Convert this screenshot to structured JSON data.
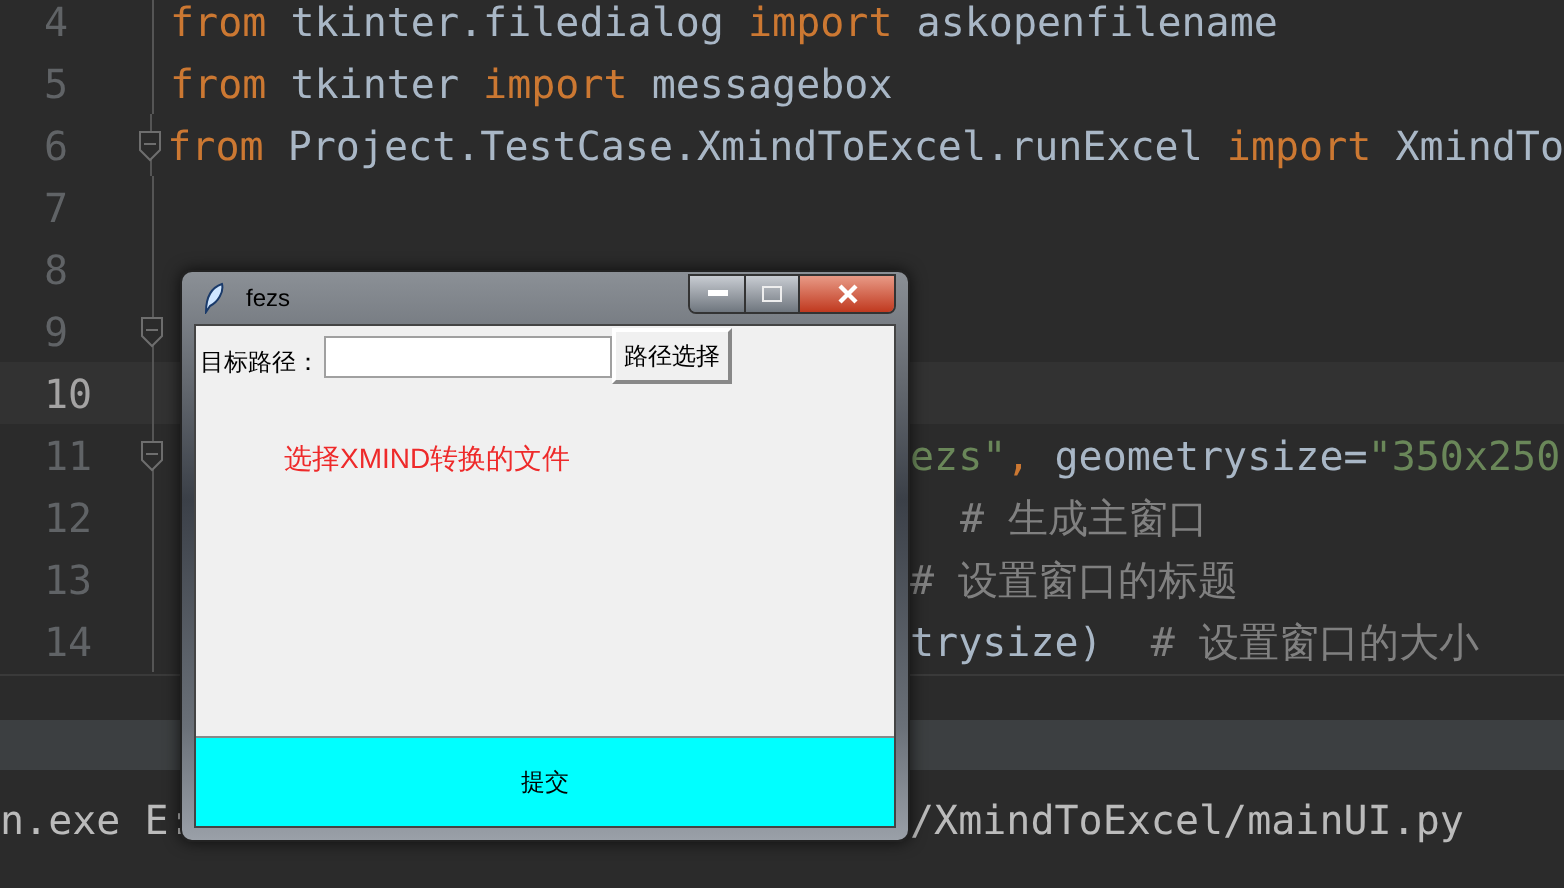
{
  "editor": {
    "lines": [
      {
        "number": "4",
        "kind": "full",
        "current": false,
        "fold": false,
        "tokens": [
          {
            "text": "from",
            "kind": "keyword"
          },
          {
            "text": " tkinter.filedialog ",
            "kind": "plain"
          },
          {
            "text": "import",
            "kind": "keyword"
          },
          {
            "text": " askopenfilename",
            "kind": "plain"
          }
        ]
      },
      {
        "number": "5",
        "kind": "full",
        "current": false,
        "fold": false,
        "tokens": [
          {
            "text": "from",
            "kind": "keyword"
          },
          {
            "text": " tkinter ",
            "kind": "plain"
          },
          {
            "text": "import",
            "kind": "keyword"
          },
          {
            "text": " messagebox",
            "kind": "plain"
          }
        ]
      },
      {
        "number": "6",
        "kind": "full",
        "current": false,
        "fold": true,
        "tokens": [
          {
            "text": "from",
            "kind": "keyword"
          },
          {
            "text": " Project.TestCase.XmindToExcel.runExcel ",
            "kind": "plain"
          },
          {
            "text": "import",
            "kind": "keyword"
          },
          {
            "text": " XmindTo",
            "kind": "plain"
          }
        ]
      },
      {
        "number": "7",
        "current": false,
        "fold": false
      },
      {
        "number": "8",
        "current": false,
        "fold": false
      },
      {
        "number": "9",
        "current": false,
        "fold": true
      },
      {
        "number": "10",
        "current": true,
        "fold": false
      },
      {
        "number": "11",
        "kind": "cut",
        "current": false,
        "fold": true,
        "tokens": [
          {
            "text": "ezs\"",
            "kind": "string"
          },
          {
            "text": ", ",
            "kind": "keyword"
          },
          {
            "text": "geometrysize",
            "kind": "plain"
          },
          {
            "text": "=",
            "kind": "plain"
          },
          {
            "text": "\"350x250",
            "kind": "string"
          }
        ]
      },
      {
        "number": "12",
        "kind": "cut_deep",
        "current": false,
        "fold": false,
        "tokens": [
          {
            "text": "# 生成主窗口",
            "kind": "comment"
          }
        ]
      },
      {
        "number": "13",
        "kind": "cut",
        "current": false,
        "fold": false,
        "tokens": [
          {
            "text": "# 设置窗口的标题",
            "kind": "comment"
          }
        ]
      },
      {
        "number": "14",
        "kind": "cut",
        "current": false,
        "fold": false,
        "tokens": [
          {
            "text": "trysize)",
            "kind": "plain"
          },
          {
            "text": "  # 设置窗口的大小",
            "kind": "comment"
          }
        ]
      }
    ]
  },
  "console": {
    "segments": [
      "n.exe E:",
      "/XmindToExcel/mainUI.py"
    ]
  },
  "window": {
    "title": "fezs",
    "path_label": "目标路径：",
    "browse_button": "路径选择",
    "hint": "选择XMIND转换的文件",
    "submit_button": "提交"
  }
}
